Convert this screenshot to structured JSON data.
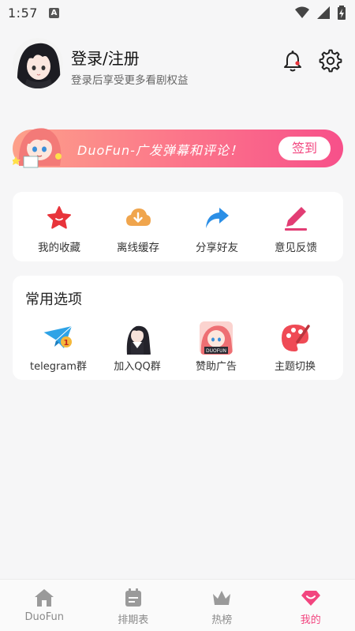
{
  "status_bar": {
    "time": "1:57",
    "notification_badge": "A"
  },
  "profile": {
    "name": "登录/注册",
    "subtitle": "登录后享受更多看剧权益",
    "avatar_icon": "anime-girl-avatar",
    "bell_icon": "bell-icon",
    "settings_icon": "gear-icon"
  },
  "banner": {
    "text": "DuoFun-广发弹幕和评论！",
    "button": "签到",
    "colors": {
      "start": "#fda08a",
      "end": "#f7508a"
    }
  },
  "quick_actions": [
    {
      "label": "我的收藏",
      "icon": "star-icon",
      "color": "#e8343b"
    },
    {
      "label": "离线缓存",
      "icon": "cloud-download-icon",
      "color": "#f0a54d"
    },
    {
      "label": "分享好友",
      "icon": "share-arrow-icon",
      "color": "#2b8fe6"
    },
    {
      "label": "意见反馈",
      "icon": "edit-pencil-icon",
      "color": "#e23d74"
    }
  ],
  "options": {
    "title": "常用选项",
    "items": [
      {
        "label": "telegram群",
        "icon": "paper-plane-icon",
        "badge": "1"
      },
      {
        "label": "加入QQ群",
        "icon": "anime-character-icon"
      },
      {
        "label": "赞助广告",
        "icon": "duofun-mascot-icon",
        "caption": "DUOFUN"
      },
      {
        "label": "主题切换",
        "icon": "palette-icon"
      }
    ]
  },
  "bottom_nav": {
    "items": [
      {
        "label": "DuoFun",
        "icon": "home-icon"
      },
      {
        "label": "排期表",
        "icon": "calendar-icon"
      },
      {
        "label": "热榜",
        "icon": "crown-icon"
      },
      {
        "label": "我的",
        "icon": "diamond-heart-icon"
      }
    ],
    "active": "我的",
    "active_color": "#f2457f"
  }
}
